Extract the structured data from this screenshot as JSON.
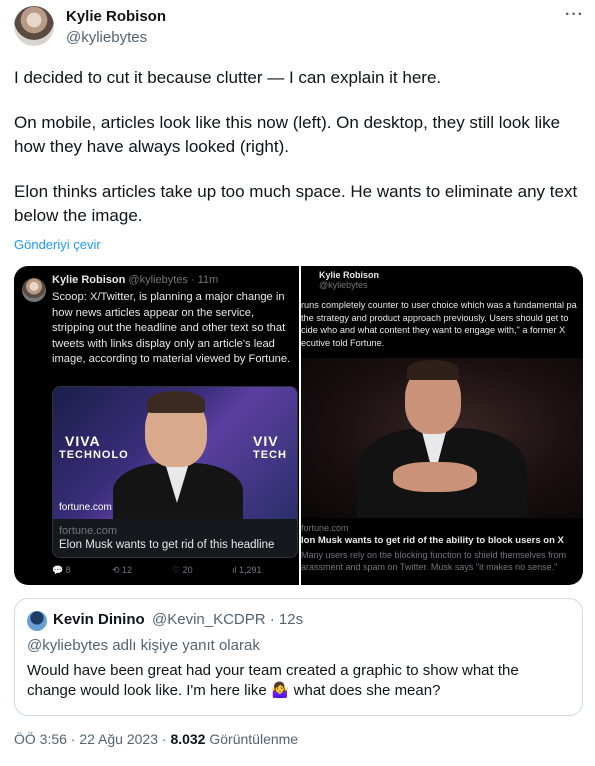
{
  "author": {
    "name": "Kylie Robison",
    "handle": "@kyliebytes"
  },
  "more_label": "···",
  "tweet": {
    "paragraphs": [
      "I decided to cut it because clutter — I can explain it here.",
      "On mobile, articles look like this now (left). On desktop, they still look like how they have always looked (right).",
      "Elon thinks articles take up too much space. He wants to eliminate any text below the image."
    ],
    "translate_label": "Gönderiyi çevir"
  },
  "left_panel": {
    "name": "Kylie Robison",
    "handle_time": "@kyliebytes · 11m",
    "text": "Scoop: X/Twitter, is planning a major change in how news articles appear on the service, stripping out the headline and other text so that tweets with links display only an article's lead image, according to material viewed by Fortune.",
    "image_brand_1": "VIVA",
    "image_brand_2": "TECHNOLO",
    "image_brand_3": "VIV",
    "image_brand_4": "TECH",
    "image_source": "fortune.com",
    "card_domain": "fortune.com",
    "card_title": "Elon Musk wants to get rid of this headline",
    "actions": {
      "replies": "8",
      "retweets": "12",
      "likes": "20",
      "views": "1,291"
    }
  },
  "right_panel": {
    "name": "Kylie Robison",
    "handle": "@kyliebytes",
    "text_lines": [
      "runs completely counter to user choice which was a fundamental pa",
      "the strategy and product approach previously. Users should get to",
      "cide who and what content they want to engage with,\" a former X",
      "ecutive told Fortune."
    ],
    "card_domain": "fortune.com",
    "card_title": "lon Musk wants to get rid of the ability to block users on X",
    "card_desc_1": "Many users rely on the blocking function to shield themselves from",
    "card_desc_2": "arassment and spam on Twitter. Musk says \"it makes no sense.\""
  },
  "quote": {
    "name": "Kevin Dinino",
    "handle_time": "@Kevin_KCDPR · 12s",
    "reply_label": "@kyliebytes adlı kişiye yanıt olarak",
    "text": "Would have been great had your team created a graphic to show what the change would look like. I'm here like 🤷‍♀️ what does she mean?"
  },
  "meta": {
    "time_date": "ÖÖ 3:56 · 22 Ağu 2023 · ",
    "views_count": "8.032",
    "views_label": " Görüntülenme"
  }
}
